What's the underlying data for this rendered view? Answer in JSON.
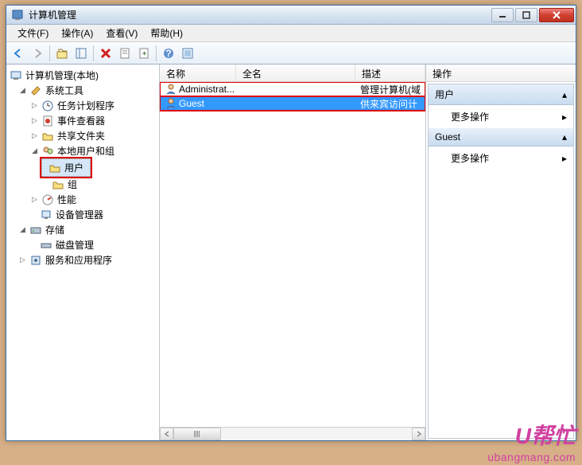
{
  "window": {
    "title": "计算机管理"
  },
  "menus": {
    "file": "文件(F)",
    "action": "操作(A)",
    "view": "查看(V)",
    "help": "帮助(H)"
  },
  "tree": {
    "root": "计算机管理(本地)",
    "system_tools": "系统工具",
    "task_scheduler": "任务计划程序",
    "event_viewer": "事件查看器",
    "shared_folders": "共享文件夹",
    "local_users_groups": "本地用户和组",
    "users": "用户",
    "groups": "组",
    "performance": "性能",
    "device_manager": "设备管理器",
    "storage": "存储",
    "disk_management": "磁盘管理",
    "services_apps": "服务和应用程序"
  },
  "list": {
    "columns": {
      "name": "名称",
      "fullname": "全名",
      "description": "描述"
    },
    "rows": [
      {
        "name": "Administrat...",
        "fullname": "",
        "description": "管理计算机(域"
      },
      {
        "name": "Guest",
        "fullname": "",
        "description": "供来宾访问计"
      }
    ]
  },
  "actions": {
    "header": "操作",
    "group1": "用户",
    "more_actions": "更多操作",
    "group2": "Guest"
  },
  "watermark": {
    "logo": "U帮忙",
    "url": "ubangmang.com"
  }
}
